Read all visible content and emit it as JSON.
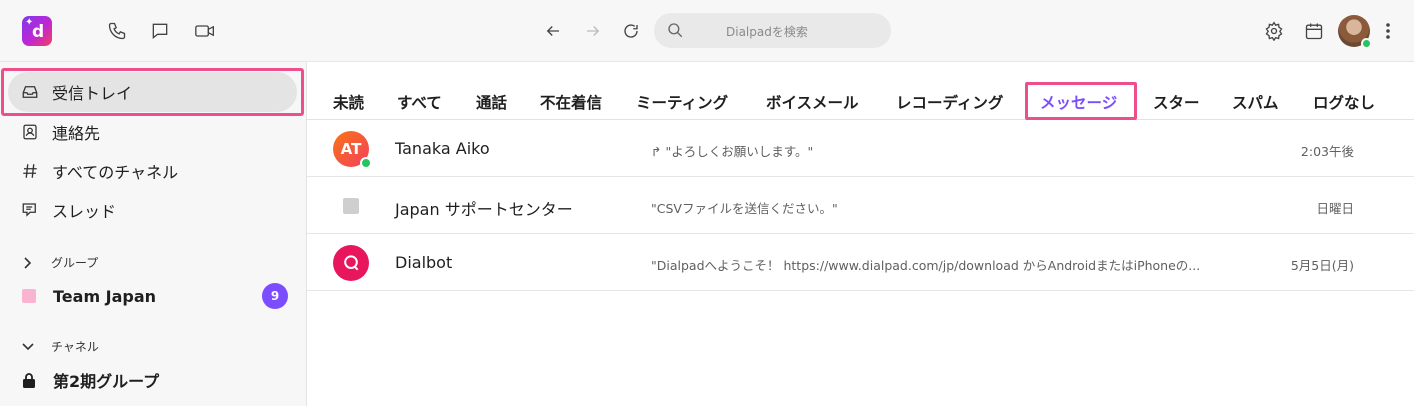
{
  "topbar": {
    "logo_letter": "d",
    "search_placeholder": "Dialpadを検索",
    "icons": [
      "phone-icon",
      "chat-icon",
      "video-icon",
      "back-arrow-icon",
      "forward-arrow-icon",
      "refresh-icon",
      "search-icon",
      "settings-icon",
      "calendar-icon",
      "more-icon"
    ],
    "presence_color": "#22c55e"
  },
  "sidebar": {
    "items": [
      {
        "label": "受信トレイ",
        "icon": "inbox-icon"
      },
      {
        "label": "連絡先",
        "icon": "contacts-icon"
      },
      {
        "label": "すべてのチャネル",
        "icon": "hash-icon"
      },
      {
        "label": "スレッド",
        "icon": "threads-icon"
      }
    ],
    "groups_header": "グループ",
    "group_item": {
      "label": "Team Japan",
      "badge": "9",
      "color": "#f8b4d0"
    },
    "channels_header": "チャネル",
    "channel_item": {
      "label": "第2期グループ",
      "icon": "lock-icon"
    }
  },
  "tabs": [
    {
      "label": "未読"
    },
    {
      "label": "すべて"
    },
    {
      "label": "通話"
    },
    {
      "label": "不在着信"
    },
    {
      "label": "ミーティング"
    },
    {
      "label": "ボイスメール"
    },
    {
      "label": "レコーディング"
    },
    {
      "label": "メッセージ",
      "active": true
    },
    {
      "label": "スター"
    },
    {
      "label": "スパム"
    },
    {
      "label": "ログなし"
    }
  ],
  "conversations": [
    {
      "initials": "AT",
      "name": "Tanaka Aiko",
      "preview": "\"よろしくお願いします。\"",
      "time": "2:03午後",
      "online": true
    },
    {
      "name": "Japan サポートセンター",
      "preview": "\"CSVファイルを送信ください。\"",
      "time": "日曜日"
    },
    {
      "name": "Dialbot",
      "preview": "\"Dialpadへようこそ！ https://www.dialpad.com/jp/download からAndroidまたはiPhoneの...",
      "time": "5月5日(月)"
    }
  ],
  "colors": {
    "accent": "#7c4dff",
    "highlight": "#ec4f8c",
    "badge": "#7c4dff"
  }
}
